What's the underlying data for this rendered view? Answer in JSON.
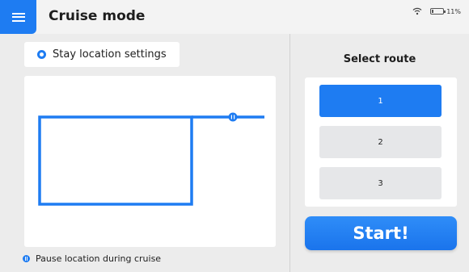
{
  "header": {
    "title": "Cruise mode",
    "battery": {
      "percent_label": "11%",
      "level": 0.11
    }
  },
  "stay_settings": {
    "label": "Stay location settings"
  },
  "legend": {
    "label": "Pause location during cruise"
  },
  "route_select": {
    "title": "Select route",
    "routes": [
      {
        "label": "1",
        "selected": true
      },
      {
        "label": "2",
        "selected": false
      },
      {
        "label": "3",
        "selected": false
      }
    ]
  },
  "start_button": {
    "label": "Start!"
  },
  "colors": {
    "accent": "#1e7cf2",
    "panel": "#ffffff",
    "background": "#ececec",
    "route_unselected": "#e6e7e9"
  }
}
